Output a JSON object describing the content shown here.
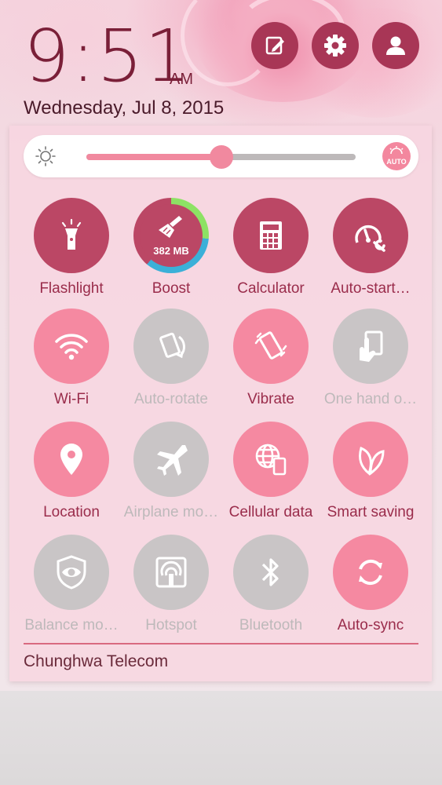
{
  "status": {
    "time": "9:51",
    "ampm": "AM",
    "date": "Wednesday, Jul 8, 2015"
  },
  "header_buttons": [
    {
      "icon": "edit-icon"
    },
    {
      "icon": "gear-icon"
    },
    {
      "icon": "user-icon"
    }
  ],
  "brightness": {
    "level_percent": 50,
    "auto_label": "AUTO"
  },
  "tiles": [
    {
      "label": "Flashlight",
      "icon": "flashlight-icon",
      "state": "dark"
    },
    {
      "label": "Boost",
      "icon": "broom-icon",
      "state": "dark",
      "value": "382 MB"
    },
    {
      "label": "Calculator",
      "icon": "calculator-icon",
      "state": "dark"
    },
    {
      "label": "Auto-start…",
      "icon": "speedometer-wrench-icon",
      "state": "dark"
    },
    {
      "label": "Wi-Fi",
      "icon": "wifi-icon",
      "state": "on"
    },
    {
      "label": "Auto-rotate",
      "icon": "rotate-icon",
      "state": "off"
    },
    {
      "label": "Vibrate",
      "icon": "vibrate-icon",
      "state": "on"
    },
    {
      "label": "One hand o…",
      "icon": "one-hand-icon",
      "state": "off"
    },
    {
      "label": "Location",
      "icon": "location-pin-icon",
      "state": "on"
    },
    {
      "label": "Airplane mo…",
      "icon": "airplane-icon",
      "state": "off"
    },
    {
      "label": "Cellular data",
      "icon": "cellular-data-icon",
      "state": "on"
    },
    {
      "label": "Smart saving",
      "icon": "leaf-icon",
      "state": "on"
    },
    {
      "label": "Balance mo…",
      "icon": "shield-eye-icon",
      "state": "off"
    },
    {
      "label": "Hotspot",
      "icon": "hotspot-icon",
      "state": "off"
    },
    {
      "label": "Bluetooth",
      "icon": "bluetooth-icon",
      "state": "off"
    },
    {
      "label": "Auto-sync",
      "icon": "sync-icon",
      "state": "on"
    }
  ],
  "carrier": "Chunghwa Telecom",
  "colors": {
    "accent_dark": "#bb4765",
    "accent_on": "#f589a1",
    "tile_off": "#c9c5c6"
  }
}
